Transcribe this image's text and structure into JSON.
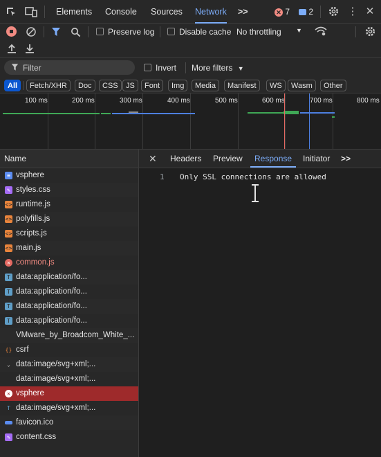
{
  "toolbar": {
    "tabs": [
      "Elements",
      "Console",
      "Sources",
      "Network"
    ],
    "active_tab": "Network",
    "more_tabs": ">>",
    "error_count": "7",
    "message_count": "2"
  },
  "network_toolbar": {
    "preserve_log": "Preserve log",
    "disable_cache": "Disable cache",
    "throttling": "No throttling"
  },
  "filter": {
    "placeholder": "Filter",
    "invert": "Invert",
    "more_filters": "More filters"
  },
  "type_filters": [
    "All",
    "Fetch/XHR",
    "Doc",
    "CSS",
    "JS",
    "Font",
    "Img",
    "Media",
    "Manifest",
    "WS",
    "Wasm",
    "Other"
  ],
  "timeline": {
    "ticks": [
      "100 ms",
      "200 ms",
      "300 ms",
      "400 ms",
      "500 ms",
      "600 ms",
      "700 ms",
      "800 ms"
    ]
  },
  "requests": {
    "header": "Name",
    "rows": [
      {
        "name": "vsphere",
        "type": "doc"
      },
      {
        "name": "styles.css",
        "type": "css"
      },
      {
        "name": "runtime.js",
        "type": "js"
      },
      {
        "name": "polyfills.js",
        "type": "js"
      },
      {
        "name": "scripts.js",
        "type": "js"
      },
      {
        "name": "main.js",
        "type": "js"
      },
      {
        "name": "common.js",
        "type": "error"
      },
      {
        "name": "data:application/fo...",
        "type": "font"
      },
      {
        "name": "data:application/fo...",
        "type": "font"
      },
      {
        "name": "data:application/fo...",
        "type": "font"
      },
      {
        "name": "data:application/fo...",
        "type": "font"
      },
      {
        "name": "VMware_by_Broadcom_White_...",
        "type": "none"
      },
      {
        "name": "csrf",
        "type": "fetch"
      },
      {
        "name": "data:image/svg+xml;...",
        "type": "chevron"
      },
      {
        "name": "data:image/svg+xml;...",
        "type": "none"
      },
      {
        "name": "vsphere",
        "type": "error"
      },
      {
        "name": "data:image/svg+xml;...",
        "type": "img"
      },
      {
        "name": "favicon.ico",
        "type": "ico"
      },
      {
        "name": "content.css",
        "type": "css"
      }
    ],
    "selected_index": 15
  },
  "detail": {
    "tabs": [
      "Headers",
      "Preview",
      "Response",
      "Initiator"
    ],
    "active_tab": "Response",
    "more": ">>",
    "response_lines": [
      {
        "no": "1",
        "text": "Only SSL connections are allowed"
      }
    ]
  },
  "colors": {
    "accent": "#7cacf8",
    "error": "#f28b82",
    "selected_row": "#9e2a2b"
  }
}
